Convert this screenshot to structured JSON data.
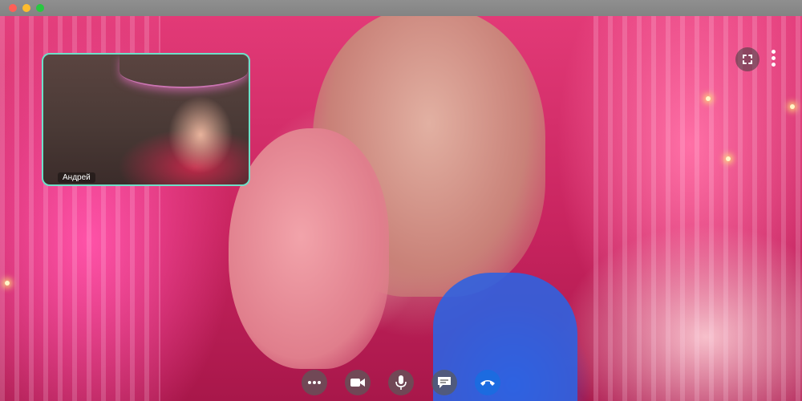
{
  "window": {
    "traffic_lights": [
      "close",
      "minimize",
      "maximize"
    ]
  },
  "pip": {
    "participant_name": "Андрей",
    "border_color": "#6ee0c8"
  },
  "top_controls": {
    "icons": [
      "expand-icon",
      "more-vertical-icon"
    ]
  },
  "controls": {
    "icons": [
      "more-horizontal-icon",
      "camera-icon",
      "microphone-icon",
      "chat-icon",
      "end-call-icon"
    ],
    "end_call_color": "#1c6be0"
  }
}
